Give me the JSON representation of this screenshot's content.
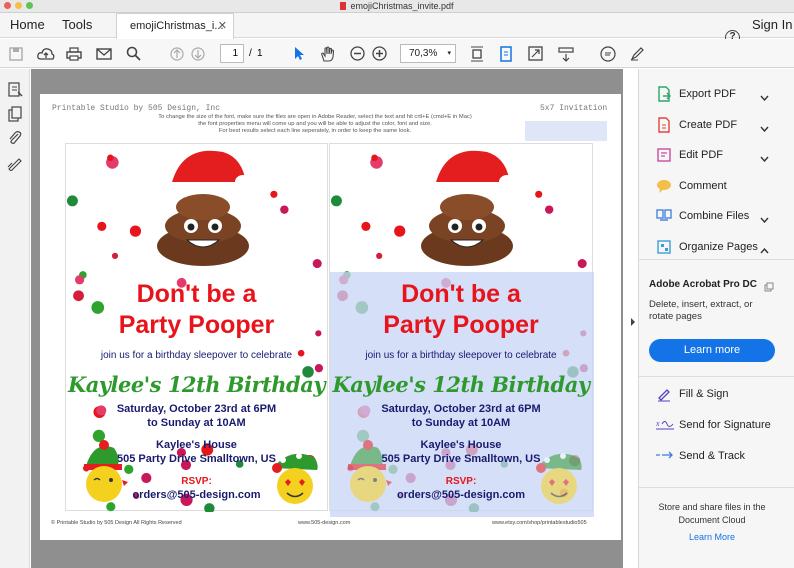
{
  "window": {
    "title": "emojiChristmas_invite.pdf"
  },
  "menu": {
    "home": "Home",
    "tools": "Tools",
    "tab_title": "emojiChristmas_i...",
    "signin": "Sign In"
  },
  "toolbar": {
    "page_current": "1",
    "page_sep": "/",
    "page_total": "1",
    "zoom": "70,3%"
  },
  "pdf": {
    "header_left": "Printable Studio by 505 Design, Inc",
    "header_right": "5x7 Invitation",
    "instructions": [
      "To change the size of the font, make sure the files are open in Adobe Reader, select the text and hit crtl+E (cmd+E in Mac)",
      "the font properties menu will come up and you will be able to adjust the color, font and size.",
      "For best results select each line seperately, in order to keep the same look."
    ],
    "headline1": "Don't be a",
    "headline2": "Party Pooper",
    "invite": "join us for a birthday sleepover to celebrate",
    "name": "Kaylee's 12th Birthday",
    "date1": "Saturday, October 23rd at 6PM",
    "date2": "to Sunday at 10AM",
    "place": "Kaylee's House",
    "address": "505 Party Drive Smalltown, US",
    "rsvp": "RSVP:",
    "email": "orders@505-design.com",
    "footer_left": "© Printable Studio by 505 Design All Rights Reserved",
    "footer_center": "www.505-design.com",
    "footer_right": "www.etsy.com/shop/printablestudio505"
  },
  "panel": {
    "tools": [
      {
        "label": "Export PDF",
        "icon": "export-pdf-icon",
        "color": "#2ea36a"
      },
      {
        "label": "Create PDF",
        "icon": "create-pdf-icon",
        "color": "#e0463c"
      },
      {
        "label": "Edit PDF",
        "icon": "edit-pdf-icon",
        "color": "#c84b9e"
      },
      {
        "label": "Comment",
        "icon": "comment-icon",
        "color": "#f2c04a"
      },
      {
        "label": "Combine Files",
        "icon": "combine-files-icon",
        "color": "#3b7dd8"
      },
      {
        "label": "Organize Pages",
        "icon": "organize-pages-icon",
        "color": "#3b9dd8"
      }
    ],
    "promo_title": "Adobe Acrobat Pro DC",
    "promo_text": "Delete, insert, extract, or rotate pages",
    "promo_button": "Learn more",
    "tools2": [
      {
        "label": "Fill & Sign",
        "icon": "fill-sign-icon"
      },
      {
        "label": "Send for Signature",
        "icon": "send-signature-icon"
      },
      {
        "label": "Send & Track",
        "icon": "send-track-icon"
      }
    ],
    "cloud_text": "Store and share files in the Document Cloud",
    "cloud_link": "Learn More"
  },
  "colors": {
    "accent": "#1473e6",
    "headline_red": "#e8141b",
    "name_green": "#2e9a2e",
    "navy": "#1a1a6e",
    "selection": "#d2dcf8"
  }
}
